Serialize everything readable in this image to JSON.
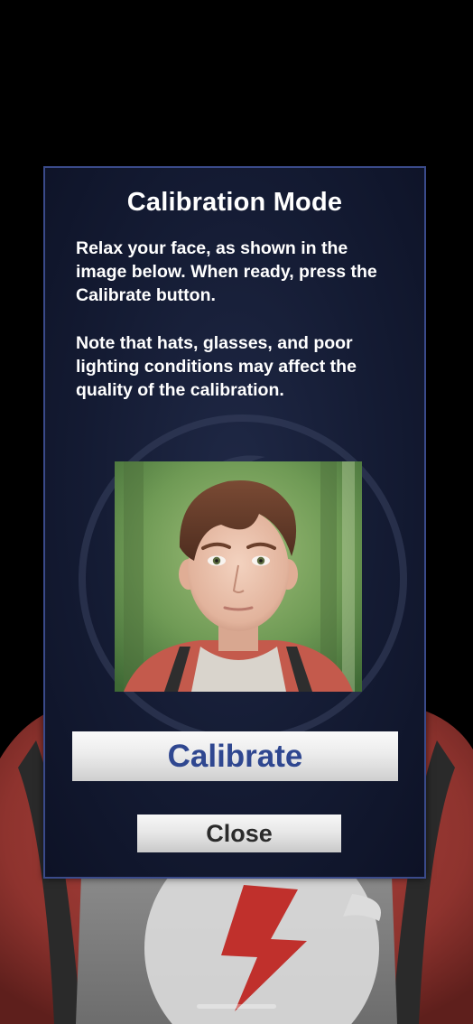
{
  "dialog": {
    "title": "Calibration Mode",
    "instructions": "Relax your face, as shown in the image below. When ready, press the Calibrate button.",
    "note": "Note that hats, glasses, and poor lighting conditions may affect the quality of the calibration.",
    "reference_image_icon": "avatar-face-reference",
    "calibrate_label": "Calibrate",
    "close_label": "Close"
  },
  "colors": {
    "dialog_background": "#141b33",
    "dialog_border": "#3a4a8a",
    "calibrate_text": "#2f4790",
    "close_text": "#2b2b2b"
  }
}
